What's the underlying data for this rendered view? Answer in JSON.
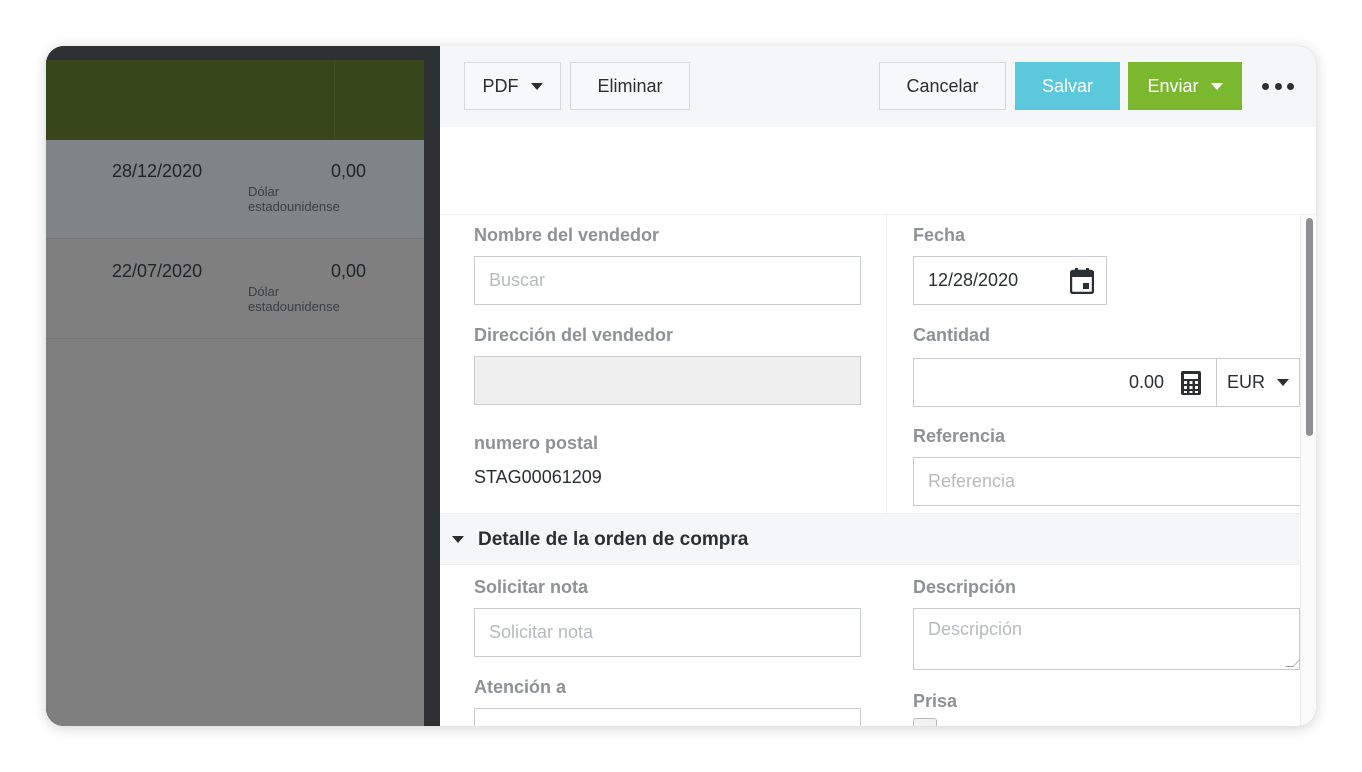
{
  "list": {
    "rows": [
      {
        "date": "28/12/2020",
        "amount": "0,00",
        "currency": "Dólar estadounidense"
      },
      {
        "date": "22/07/2020",
        "amount": "0,00",
        "currency": "Dólar estadounidense"
      }
    ]
  },
  "toolbar": {
    "pdf_label": "PDF",
    "delete_label": "Eliminar",
    "cancel_label": "Cancelar",
    "save_label": "Salvar",
    "send_label": "Enviar"
  },
  "form": {
    "vendor_name": {
      "label": "Nombre del vendedor",
      "placeholder": "Buscar"
    },
    "vendor_address": {
      "label": "Dirección del vendedor",
      "value": ""
    },
    "postal_number": {
      "label": "numero postal",
      "value": "STAG00061209"
    },
    "date": {
      "label": "Fecha",
      "value": "12/28/2020"
    },
    "amount": {
      "label": "Cantidad",
      "value": "0.00",
      "currency": "EUR"
    },
    "reference": {
      "label": "Referencia",
      "placeholder": "Referencia"
    }
  },
  "section": {
    "title": "Detalle de la orden de compra",
    "request_note": {
      "label": "Solicitar nota",
      "placeholder": "Solicitar nota"
    },
    "attention": {
      "label": "Atención a"
    },
    "description": {
      "label": "Descripción",
      "placeholder": "Descripción"
    },
    "rush": {
      "label": "Prisa"
    }
  },
  "colors": {
    "save_button": "#5bc8dc",
    "send_button": "#7cb82f",
    "list_header": "#36461a"
  }
}
